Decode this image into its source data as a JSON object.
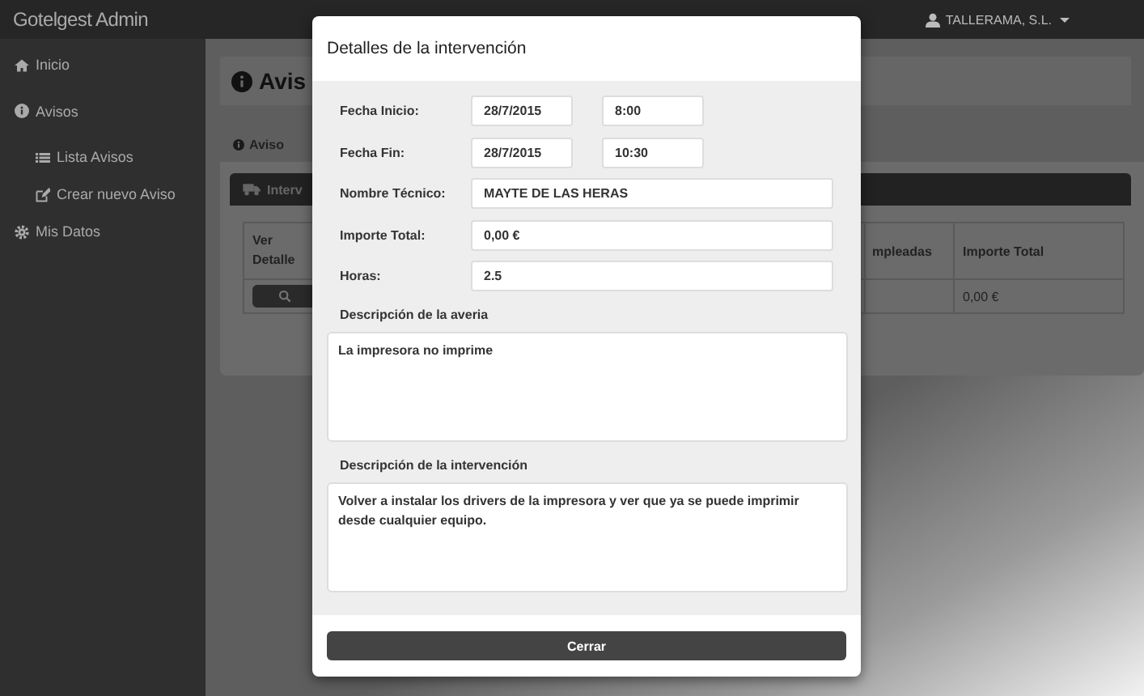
{
  "navbar": {
    "brand": "Gotelgest Admin",
    "user_menu": "TALLERAMA, S.L."
  },
  "sidebar": {
    "items": [
      {
        "label": "Inicio"
      },
      {
        "label": "Avisos",
        "children": [
          {
            "label": "Lista Avisos"
          },
          {
            "label": "Crear nuevo Aviso"
          }
        ]
      },
      {
        "label": "Mis Datos"
      }
    ]
  },
  "page": {
    "title": "Avis",
    "tabs": [
      {
        "label": "Aviso",
        "selected": false
      }
    ],
    "panel": {
      "title": "Interv",
      "table": {
        "columns": [
          "Ver Detalle",
          "mpleadas",
          "Importe Total"
        ],
        "rows": [
          {
            "importe_total": "0,00 €"
          }
        ]
      }
    }
  },
  "modal": {
    "title": "Detalles de la intervención",
    "fields": [
      {
        "label": "Fecha Inicio:",
        "values": [
          "28/7/2015",
          "8:00"
        ]
      },
      {
        "label": "Fecha Fin:",
        "values": [
          "28/7/2015",
          "10:30"
        ]
      },
      {
        "label": "Nombre Técnico:",
        "values": [
          "MAYTE DE LAS HERAS"
        ]
      },
      {
        "label": "Importe Total:",
        "values": [
          "0,00 €"
        ]
      },
      {
        "label": "Horas:",
        "values": [
          "2.5"
        ]
      }
    ],
    "descriptions": [
      {
        "label": "Descripción de la averia",
        "value": "La impresora no imprime"
      },
      {
        "label": "Descripción de la intervención",
        "value": "Volver a instalar los drivers de la impresora y ver que ya se puede imprimir desde cualquier equipo."
      }
    ],
    "button": "Cerrar"
  }
}
